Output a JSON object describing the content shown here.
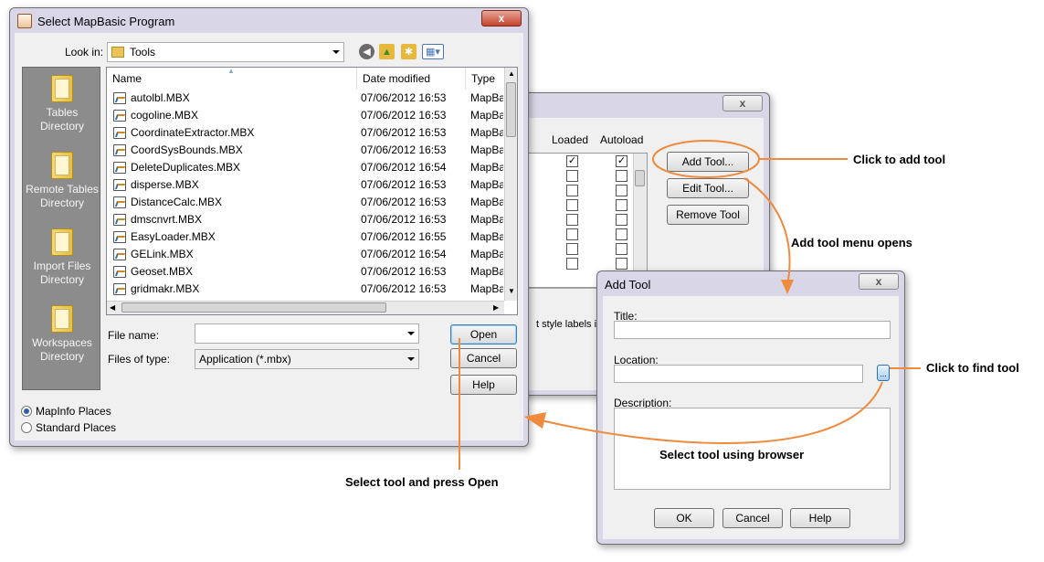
{
  "colors": {
    "accent_orange": "#f08a3c",
    "selection_blue": "#3399ff"
  },
  "select_dialog": {
    "title": "Select MapBasic Program",
    "close_glyph": "x",
    "look_in_label": "Look in:",
    "look_in_value": "Tools",
    "toolbar_icons": [
      "back-icon",
      "up-folder-icon",
      "new-folder-icon",
      "view-menu-icon"
    ],
    "places": [
      {
        "label": "Tables Directory"
      },
      {
        "label": "Remote Tables Directory"
      },
      {
        "label": "Import Files Directory"
      },
      {
        "label": "Workspaces Directory"
      }
    ],
    "columns": [
      "Name",
      "Date modified",
      "Type"
    ],
    "files": [
      {
        "name": "autolbl.MBX",
        "date": "07/06/2012 16:53",
        "type": "MapBa"
      },
      {
        "name": "cogoline.MBX",
        "date": "07/06/2012 16:53",
        "type": "MapBa"
      },
      {
        "name": "CoordinateExtractor.MBX",
        "date": "07/06/2012 16:53",
        "type": "MapBa"
      },
      {
        "name": "CoordSysBounds.MBX",
        "date": "07/06/2012 16:53",
        "type": "MapBa"
      },
      {
        "name": "DeleteDuplicates.MBX",
        "date": "07/06/2012 16:54",
        "type": "MapBa"
      },
      {
        "name": "disperse.MBX",
        "date": "07/06/2012 16:53",
        "type": "MapBa"
      },
      {
        "name": "DistanceCalc.MBX",
        "date": "07/06/2012 16:53",
        "type": "MapBa"
      },
      {
        "name": "dmscnvrt.MBX",
        "date": "07/06/2012 16:53",
        "type": "MapBa"
      },
      {
        "name": "EasyLoader.MBX",
        "date": "07/06/2012 16:55",
        "type": "MapBa"
      },
      {
        "name": "GELink.MBX",
        "date": "07/06/2012 16:54",
        "type": "MapBa"
      },
      {
        "name": "Geoset.MBX",
        "date": "07/06/2012 16:53",
        "type": "MapBa"
      },
      {
        "name": "gridmakr.MBX",
        "date": "07/06/2012 16:53",
        "type": "MapBa"
      }
    ],
    "file_name_label": "File name:",
    "file_name_value": "",
    "files_of_type_label": "Files of type:",
    "files_of_type_value": "Application (*.mbx)",
    "open_label": "Open",
    "cancel_label": "Cancel",
    "help_label": "Help",
    "radio_mapinfo": "MapInfo Places",
    "radio_standard": "Standard Places"
  },
  "tool_manager": {
    "col_loaded": "Loaded",
    "col_autoload": "Autoload",
    "add_tool_label": "Add Tool...",
    "edit_tool_label": "Edit Tool...",
    "remove_tool_label": "Remove Tool",
    "partial_text": "t style labels in",
    "rows": [
      {
        "loaded": true,
        "autoload": true
      },
      {
        "loaded": false,
        "autoload": false
      },
      {
        "loaded": false,
        "autoload": false
      },
      {
        "loaded": false,
        "autoload": false
      },
      {
        "loaded": false,
        "autoload": false
      },
      {
        "loaded": false,
        "autoload": false
      },
      {
        "loaded": false,
        "autoload": false
      },
      {
        "loaded": false,
        "autoload": false
      }
    ]
  },
  "add_tool_dialog": {
    "title": "Add Tool",
    "close_glyph": "x",
    "title_label": "Title:",
    "location_label": "Location:",
    "description_label": "Description:",
    "browse_glyph": "...",
    "ok_label": "OK",
    "cancel_label": "Cancel",
    "help_label": "Help"
  },
  "annotations": {
    "click_add": "Click to add tool",
    "menu_opens": "Add tool menu opens",
    "click_find": "Click to find tool",
    "select_browser": "Select tool using browser",
    "select_open": "Select tool and press Open"
  }
}
